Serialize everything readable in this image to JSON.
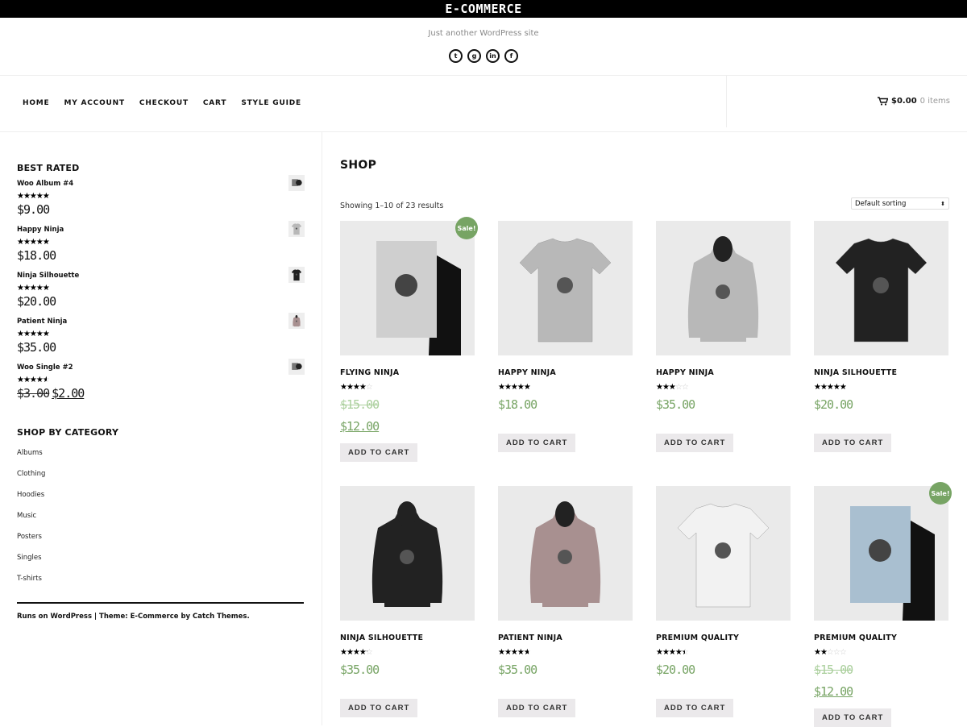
{
  "site": {
    "title": "E-COMMERCE",
    "tagline": "Just another WordPress site",
    "social": [
      {
        "icon": "twitter-icon",
        "glyph": "t"
      },
      {
        "icon": "github-icon",
        "glyph": "g"
      },
      {
        "icon": "linkedin-icon",
        "glyph": "in"
      },
      {
        "icon": "facebook-icon",
        "glyph": "f"
      }
    ]
  },
  "nav": {
    "items": [
      "HOME",
      "MY ACCOUNT",
      "CHECKOUT",
      "CART",
      "STYLE GUIDE"
    ]
  },
  "cart": {
    "amount": "$0.00",
    "items": "0 items"
  },
  "sidebar": {
    "best_rated_title": "BEST RATED",
    "best_rated": [
      {
        "name": "Woo Album #4",
        "rating": 5,
        "price": "$9.00",
        "thumb": "album"
      },
      {
        "name": "Happy Ninja",
        "rating": 5,
        "price": "$18.00",
        "thumb": "tshirt-gray"
      },
      {
        "name": "Ninja Silhouette",
        "rating": 5,
        "price": "$20.00",
        "thumb": "tshirt-black"
      },
      {
        "name": "Patient Ninja",
        "rating": 5,
        "price": "$35.00",
        "thumb": "hoodie-pink"
      },
      {
        "name": "Woo Single #2",
        "rating": 4.7,
        "old_price": "$3.00",
        "price": "$2.00",
        "thumb": "album"
      }
    ],
    "category_title": "SHOP BY CATEGORY",
    "categories": [
      "Albums",
      "Clothing",
      "Hoodies",
      "Music",
      "Posters",
      "Singles",
      "T-shirts"
    ],
    "footer": "Runs on WordPress | Theme: E-Commerce by Catch Themes."
  },
  "main": {
    "title": "SHOP",
    "showing": "Showing 1–10 of 23 results",
    "sorting": "Default sorting",
    "add_to_cart": "ADD TO CART",
    "sale_badge": "Sale!",
    "accent": "#77a464",
    "products": [
      {
        "name": "FLYING NINJA",
        "rating": 4,
        "old_price": "$15.00",
        "price": "$12.00",
        "sale": true,
        "image": "poster-ninja"
      },
      {
        "name": "HAPPY NINJA",
        "rating": 5,
        "price": "$18.00",
        "image": "tshirt-gray"
      },
      {
        "name": "HAPPY NINJA",
        "rating": 3,
        "price": "$35.00",
        "image": "hoodie-gray"
      },
      {
        "name": "NINJA SILHOUETTE",
        "rating": 5,
        "price": "$20.00",
        "image": "tshirt-black"
      },
      {
        "name": "NINJA SILHOUETTE",
        "rating": 4.3,
        "price": "$35.00",
        "image": "hoodie-black"
      },
      {
        "name": "PATIENT NINJA",
        "rating": 4.8,
        "price": "$35.00",
        "image": "hoodie-pink"
      },
      {
        "name": "PREMIUM QUALITY",
        "rating": 4.5,
        "price": "$20.00",
        "image": "tshirt-white"
      },
      {
        "name": "PREMIUM QUALITY",
        "rating": 2,
        "old_price": "$15.00",
        "price": "$12.00",
        "sale": true,
        "image": "poster-woo"
      }
    ]
  }
}
